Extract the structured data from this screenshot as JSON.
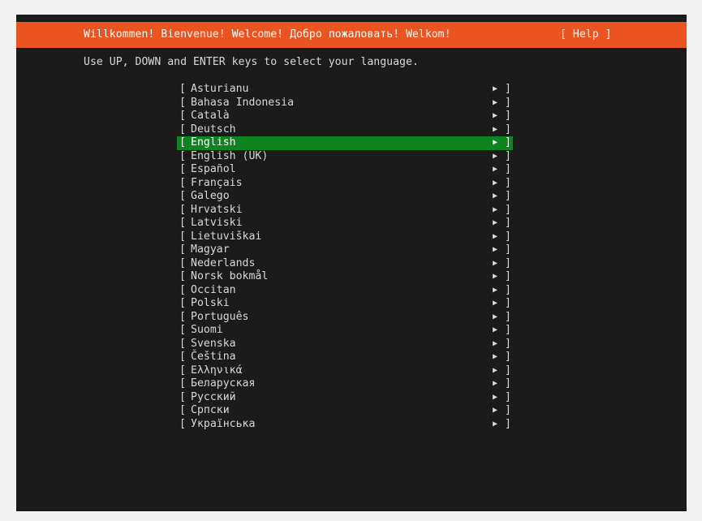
{
  "header": {
    "title": "Willkommen! Bienvenue! Welcome! Добро пожаловать! Welkom!",
    "help_label": "[ Help ]",
    "color": "#e95420"
  },
  "instructions": "Use UP, DOWN and ENTER keys to select your language.",
  "list": {
    "left_bracket": "[",
    "right_bracket": "]",
    "arrow_icon": "▶",
    "selected_color": "#0e8420",
    "selected_index": 4,
    "languages": [
      "Asturianu",
      "Bahasa Indonesia",
      "Català",
      "Deutsch",
      "English",
      "English (UK)",
      "Español",
      "Français",
      "Galego",
      "Hrvatski",
      "Latviski",
      "Lietuviškai",
      "Magyar",
      "Nederlands",
      "Norsk bokmål",
      "Occitan",
      "Polski",
      "Português",
      "Suomi",
      "Svenska",
      "Čeština",
      "Ελληνικά",
      "Беларуская",
      "Русский",
      "Српски",
      "Українська"
    ]
  }
}
